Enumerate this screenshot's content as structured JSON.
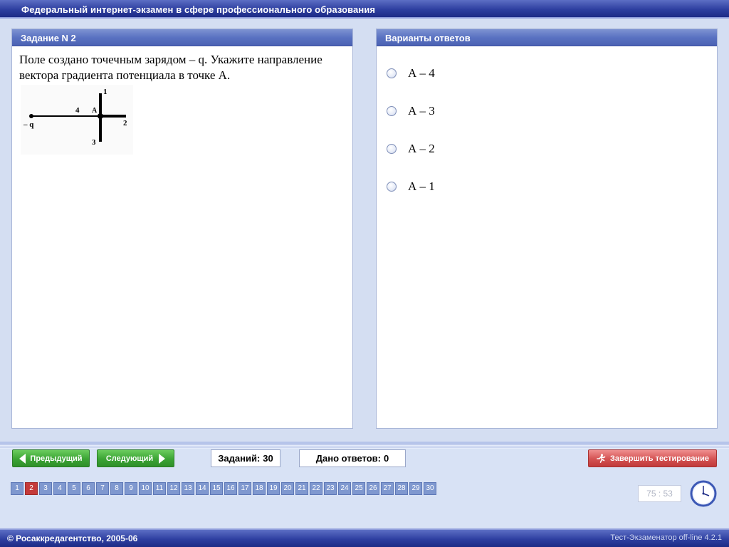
{
  "window": {
    "title": "Федеральный интернет-экзамен в сфере профессионального образования"
  },
  "question_panel": {
    "header": "Задание N 2",
    "text": "Поле создано точечным зарядом – q. Укажите направление вектора градиента потенциала в точке А.",
    "figure": {
      "charge_label": "– q",
      "point_label": "А",
      "dir_1": "1",
      "dir_2": "2",
      "dir_3": "3",
      "dir_4": "4"
    }
  },
  "answers_panel": {
    "header": "Варианты ответов",
    "options": [
      {
        "label": "А – 4",
        "selected": false
      },
      {
        "label": "А – 3",
        "selected": false
      },
      {
        "label": "А – 2",
        "selected": false
      },
      {
        "label": "А – 1",
        "selected": false
      }
    ]
  },
  "toolbar": {
    "prev_label": "Предыдущий",
    "next_label": "Следующий",
    "total_label": "Заданий:",
    "total_value": "30",
    "answered_label": "Дано ответов:",
    "answered_value": "0",
    "finish_label": "Завершить тестирование"
  },
  "question_nav": {
    "current": "2",
    "items": [
      "1",
      "2",
      "3",
      "4",
      "5",
      "6",
      "7",
      "8",
      "9",
      "10",
      "11",
      "12",
      "13",
      "14",
      "15",
      "16",
      "17",
      "18",
      "19",
      "20",
      "21",
      "22",
      "23",
      "24",
      "25",
      "26",
      "27",
      "28",
      "29",
      "30"
    ]
  },
  "timer": {
    "value": "75 : 53"
  },
  "footer": {
    "copyright": "© Росаккредагентство, 2005-06",
    "version": "Тест-Экзаменатор off-line 4.2.1"
  },
  "colors": {
    "title_bar": "#2e3fa0",
    "panel_header": "#5a72c2",
    "nav_button": "#3ba434",
    "finish_button": "#d45252",
    "current_question": "#c43a3a",
    "question_cell": "#7f98cf"
  },
  "icons": {
    "prev": "arrow-left-icon",
    "next": "arrow-right-icon",
    "finish": "running-man-icon",
    "clock": "clock-icon"
  }
}
